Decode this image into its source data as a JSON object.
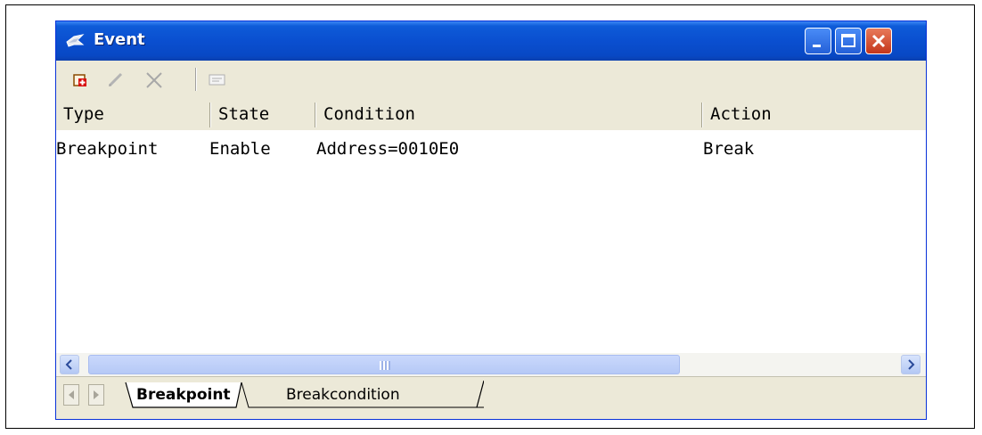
{
  "window": {
    "title": "Event",
    "icon": "event-tool-icon"
  },
  "toolbar": {
    "buttons": [
      {
        "name": "add-event",
        "icon": "add-doc-icon"
      },
      {
        "name": "edit-event",
        "icon": "pencil-icon"
      },
      {
        "name": "delete-event",
        "icon": "delete-x-icon"
      },
      {
        "name": "properties",
        "icon": "list-icon"
      }
    ]
  },
  "table": {
    "columns": [
      "Type",
      "State",
      "Condition",
      "Action"
    ],
    "rows": [
      {
        "type": "Breakpoint",
        "state": "Enable",
        "condition": "Address=0010E0",
        "action": "Break"
      }
    ]
  },
  "tabs": [
    {
      "label": "Breakpoint",
      "active": true
    },
    {
      "label": "Breakcondition",
      "active": false
    }
  ],
  "colors": {
    "titlebar": "#0A4FD0",
    "window_face": "#ECE9D8",
    "close_button": "#C4361B"
  }
}
